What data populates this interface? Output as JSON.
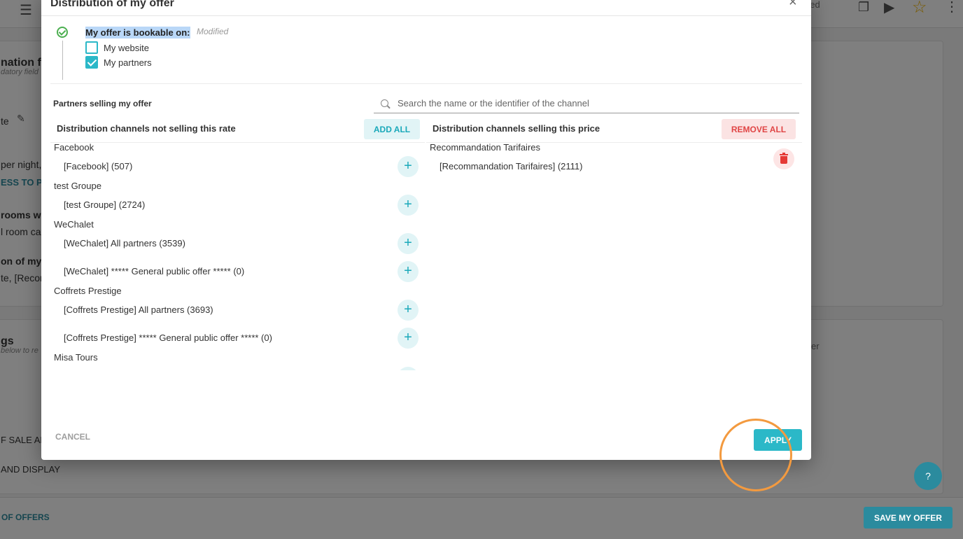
{
  "modal": {
    "title": "Distribution of my offer",
    "close_glyph": "×",
    "bookable_label": "My offer is bookable on:",
    "modified_tag": "Modified",
    "options": [
      {
        "label": "My website",
        "checked": false
      },
      {
        "label": "My partners",
        "checked": true
      }
    ],
    "partners_title": "Partners selling my offer",
    "search_placeholder": "Search the name or the identifier of the channel",
    "left_header": "Distribution channels not selling this rate",
    "add_all_label": "ADD ALL",
    "right_header": "Distribution channels selling this price",
    "remove_all_label": "REMOVE ALL",
    "left_groups": [
      {
        "name": "Facebook",
        "channels": [
          "[Facebook] (507)"
        ]
      },
      {
        "name": "test Groupe",
        "channels": [
          "[test Groupe] (2724)"
        ]
      },
      {
        "name": "WeChalet",
        "channels": [
          "[WeChalet] All partners (3539)",
          "[WeChalet] ***** General public offer ***** (0)"
        ]
      },
      {
        "name": "Coffrets Prestige",
        "channels": [
          "[Coffrets Prestige] All partners (3693)",
          "[Coffrets Prestige] ***** General public offer ***** (0)"
        ]
      },
      {
        "name": "Misa Tours",
        "channels": []
      }
    ],
    "right_groups": [
      {
        "name": "Recommandation Tarifaires",
        "channels": [
          "[Recommandation Tarifaires] (2111)"
        ]
      }
    ],
    "cancel_label": "CANCEL",
    "apply_label": "APPLY"
  },
  "background": {
    "fragments": [
      "ned",
      "nation fo",
      "datory field",
      "te",
      "per night, p",
      "ESS TO PR",
      "rooms wi",
      "l room cat",
      "on of my c",
      "te, [Recom",
      "gs",
      "below to re",
      "er",
      "F SALE AN",
      "AND DISPLAY"
    ],
    "bottom_link": "OF OFFERS",
    "save_label": "SAVE MY OFFER",
    "help_label": "?"
  },
  "colors": {
    "accent": "#2bb8c8",
    "danger": "#e04545",
    "success": "#4caf50",
    "dark_teal": "#2b8b9e",
    "click_ring": "#f39a3f"
  }
}
